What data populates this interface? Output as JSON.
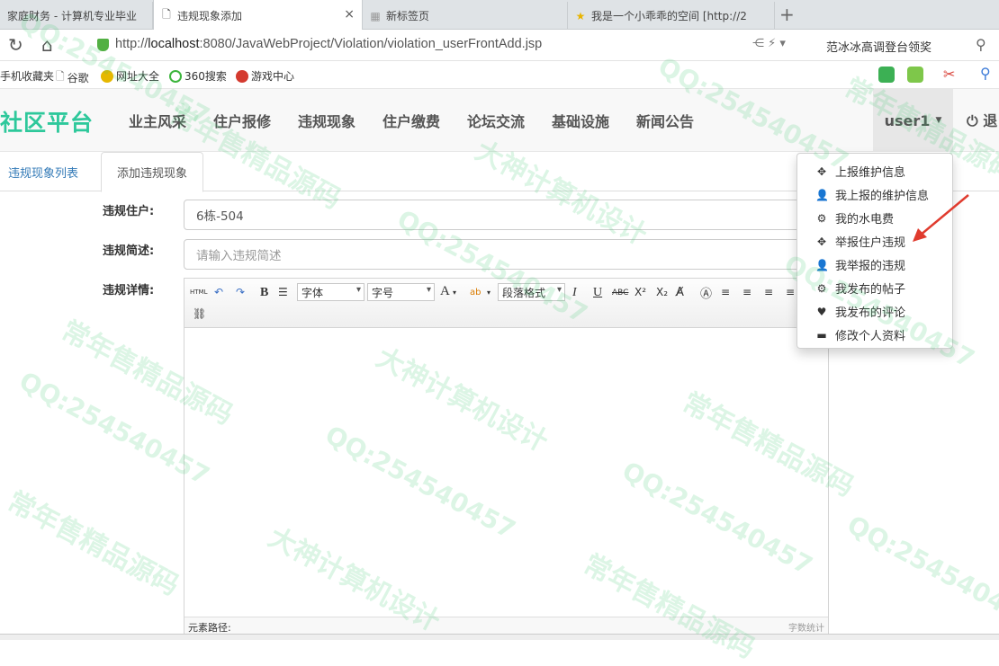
{
  "browser": {
    "tabs": [
      {
        "label": "家庭财务 - 计算机专业毕业"
      },
      {
        "label": "违规现象添加",
        "close": "×"
      },
      {
        "label": "新标签页"
      },
      {
        "label": "我是一个小乖乖的空间 [http://2"
      }
    ],
    "new_tab": "+",
    "url_prefix": "http://",
    "url_host": "localhost",
    "url_rest": ":8080/JavaWebProject/Violation/violation_userFrontAdd.jsp",
    "ad_text": "范冰冰高调登台领奖",
    "bookmarks": [
      "手机收藏夹",
      "谷歌",
      "网址大全",
      "360搜索",
      "游戏中心"
    ]
  },
  "site": {
    "brand": "社区平台",
    "nav": [
      "业主风采",
      "住户报修",
      "违规现象",
      "住户缴费",
      "论坛交流",
      "基础设施",
      "新闻公告"
    ],
    "user": "user1",
    "logout_label": "退"
  },
  "tabs": {
    "list_label": "违规现象列表",
    "add_label": "添加违规现象"
  },
  "form": {
    "resident_label": "违规住户:",
    "resident_value": "6栋-504",
    "brief_label": "违规简述:",
    "brief_placeholder": "请输入违规简述",
    "detail_label": "违规详情:"
  },
  "editor": {
    "html_btn": "HTML",
    "font_family": "字体",
    "font_size": "字号",
    "paragraph": "段落格式",
    "status_path": "元素路径:",
    "word_count": "字数统计"
  },
  "dropdown": {
    "items": [
      {
        "label": "上报维护信息",
        "icon": "move-icon"
      },
      {
        "label": "我上报的维护信息",
        "icon": "user-icon"
      },
      {
        "label": "我的水电费",
        "icon": "gear-icon"
      },
      {
        "label": "举报住户违规",
        "icon": "move-icon"
      },
      {
        "label": "我举报的违规",
        "icon": "user-icon"
      },
      {
        "label": "我发布的帖子",
        "icon": "gear-icon"
      },
      {
        "label": "我发布的评论",
        "icon": "heart-icon"
      },
      {
        "label": "修改个人资料",
        "icon": "card-icon"
      }
    ]
  },
  "watermarks": [
    "QQ:254540457",
    "常年售精品源码",
    "大神计算机设计"
  ],
  "colors": {
    "brand": "#2ec89b",
    "link": "#337ab7",
    "arrow": "#e03b2e"
  }
}
